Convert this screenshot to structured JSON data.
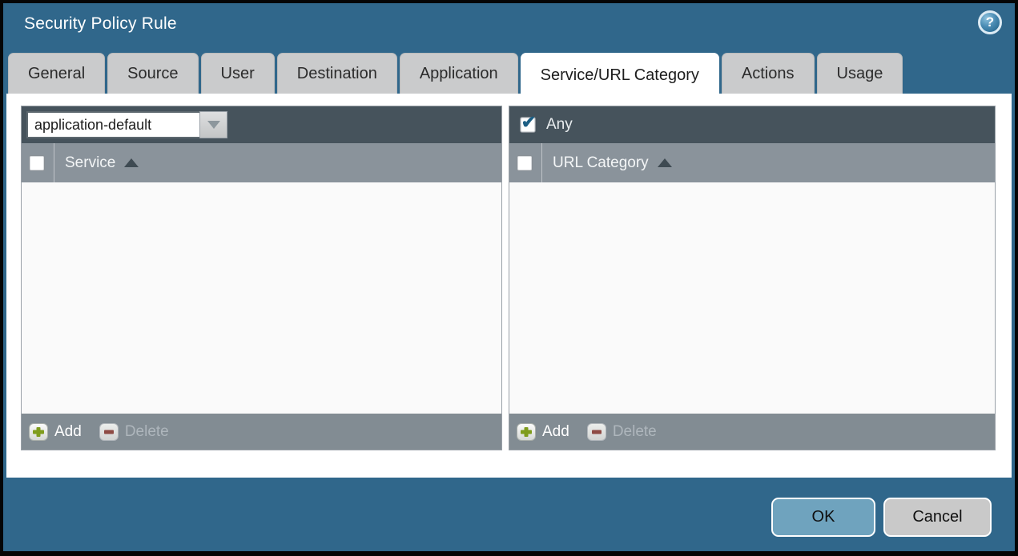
{
  "window": {
    "title": "Security Policy Rule"
  },
  "icons": {
    "help_glyph": "?",
    "check_glyph": "✔"
  },
  "tabs": [
    {
      "label": "General",
      "active": false
    },
    {
      "label": "Source",
      "active": false
    },
    {
      "label": "User",
      "active": false
    },
    {
      "label": "Destination",
      "active": false
    },
    {
      "label": "Application",
      "active": false
    },
    {
      "label": "Service/URL Category",
      "active": true
    },
    {
      "label": "Actions",
      "active": false
    },
    {
      "label": "Usage",
      "active": false
    }
  ],
  "service_panel": {
    "dropdown_value": "application-default",
    "column_header": "Service",
    "rows": [],
    "add_label": "Add",
    "delete_label": "Delete",
    "delete_enabled": false
  },
  "url_category_panel": {
    "any_label": "Any",
    "any_checked": true,
    "column_header": "URL Category",
    "rows": [],
    "add_label": "Add",
    "delete_label": "Delete",
    "delete_enabled": false
  },
  "dialog_buttons": {
    "ok_label": "OK",
    "cancel_label": "Cancel"
  },
  "colors": {
    "background_teal": "#30678B",
    "panel_header_dark": "#46535C",
    "column_header_gray": "#8A939B",
    "footer_gray": "#828C93",
    "tab_gray": "#CACBCC",
    "active_tab_white": "#FFFFFF",
    "ok_button_blue": "#6FA3BE",
    "cancel_button_gray": "#C9C9C9",
    "add_plus_green": "#7F9C1C",
    "delete_minus_red": "#8E4B44",
    "check_blue": "#1C5E84"
  }
}
